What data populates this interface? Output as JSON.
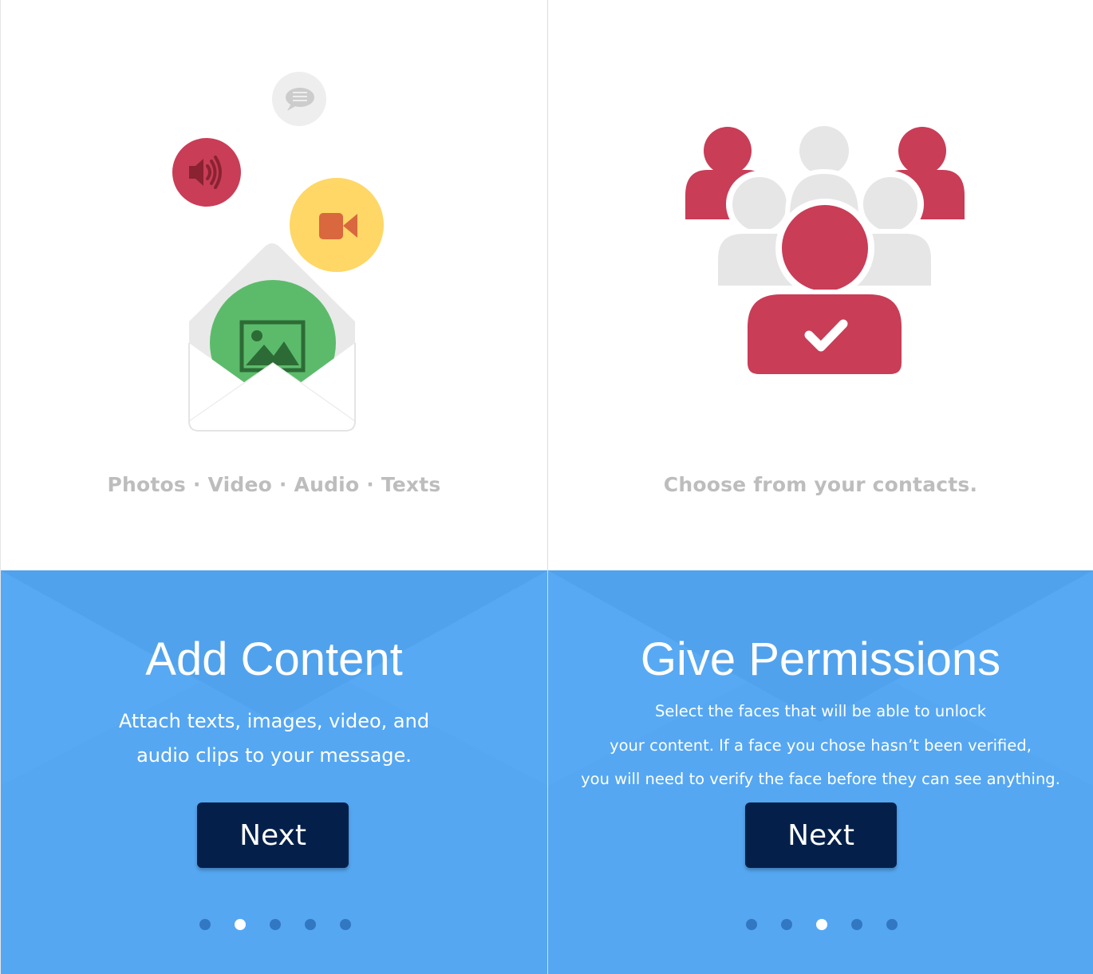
{
  "colors": {
    "blue_bg": "#55a7f2",
    "button": "#04204a",
    "red": "#c93d57",
    "green": "#5cbb6b",
    "yellow": "#fed766",
    "orange": "#d9683e",
    "gray": "#e6e6e6",
    "caption": "#bdbdbd"
  },
  "slides": [
    {
      "caption": "Photos · Video · Audio · Texts",
      "title": "Add Content",
      "description_lines": [
        "Attach texts, images, video, and",
        "audio clips to your message."
      ],
      "button_label": "Next",
      "dots_total": 5,
      "active_dot": 1,
      "icons": [
        "chat-bubble-icon",
        "speaker-icon",
        "video-camera-icon",
        "envelope-icon",
        "image-icon"
      ]
    },
    {
      "caption": "Choose from your contacts.",
      "title": "Give Permissions",
      "description_lines": [
        "Select the faces that will be able to unlock",
        "your content. If a face you chose hasn’t been verified,",
        "you will need to verify the face before they can see anything."
      ],
      "button_label": "Next",
      "dots_total": 5,
      "active_dot": 2,
      "icons": [
        "contacts-group-icon",
        "checkmark-icon"
      ]
    }
  ]
}
